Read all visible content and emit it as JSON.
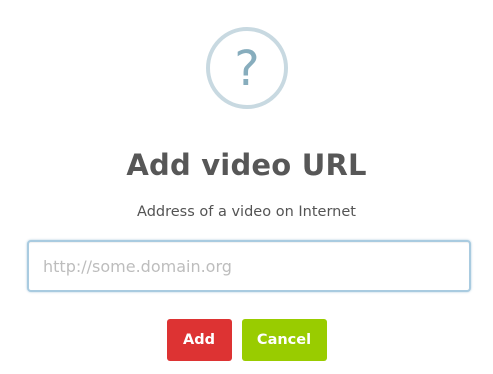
{
  "dialog": {
    "icon": "question-mark-icon",
    "icon_glyph": "?",
    "title": "Add video URL",
    "subtitle": "Address of a video on Internet",
    "input": {
      "value": "",
      "placeholder": "http://some.domain.org"
    },
    "buttons": {
      "add_label": "Add",
      "cancel_label": "Cancel"
    }
  },
  "colors": {
    "add_button": "#dd3333",
    "cancel_button": "#99cc00",
    "icon_ring": "#c8d9e1",
    "icon_glyph": "#87adbd",
    "input_border": "#a9cbe0"
  }
}
